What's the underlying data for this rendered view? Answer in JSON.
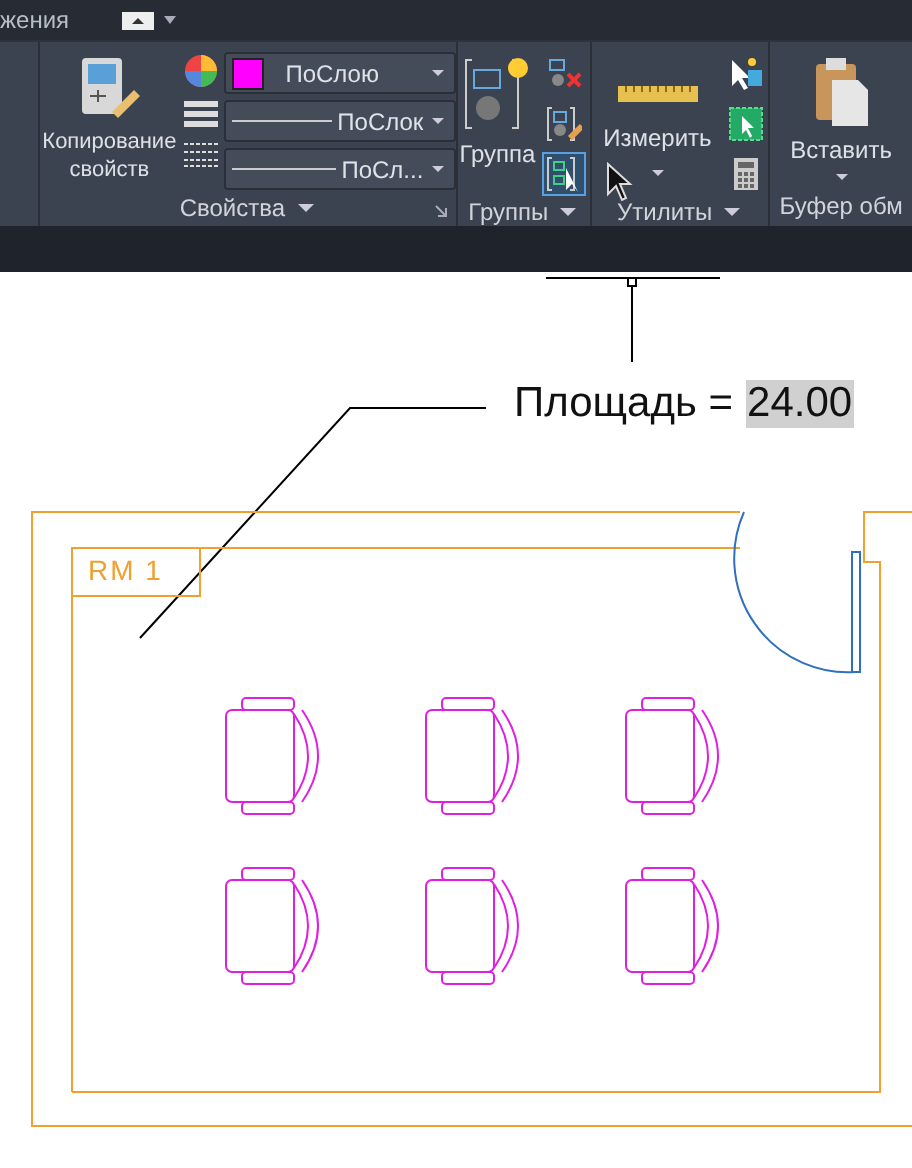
{
  "top_bar": {
    "tab_fragment": "жения"
  },
  "ribbon": {
    "panels": [
      {
        "kind": "properties",
        "title": "Свойства",
        "copy_button": "Копирование свойств",
        "dropdowns": [
          {
            "kind": "color",
            "value": "ПоСлою",
            "color": "#ff00ff"
          },
          {
            "kind": "lineweight",
            "value": "ПоСлок"
          },
          {
            "kind": "linetype",
            "value": "ПоСл..."
          }
        ]
      },
      {
        "kind": "groups",
        "title": "Группы",
        "main_button": "Группа",
        "tools": [
          {
            "selected": false
          },
          {
            "selected": false
          },
          {
            "selected": true
          }
        ]
      },
      {
        "kind": "utilities",
        "title": "Утилиты",
        "main_button": "Измерить"
      },
      {
        "kind": "clipboard",
        "title": "Буфер обм",
        "main_button": "Вставить"
      }
    ]
  },
  "drawing": {
    "area_label": "Площадь =",
    "area_value": "24.00",
    "room_tag": "RM 1"
  }
}
